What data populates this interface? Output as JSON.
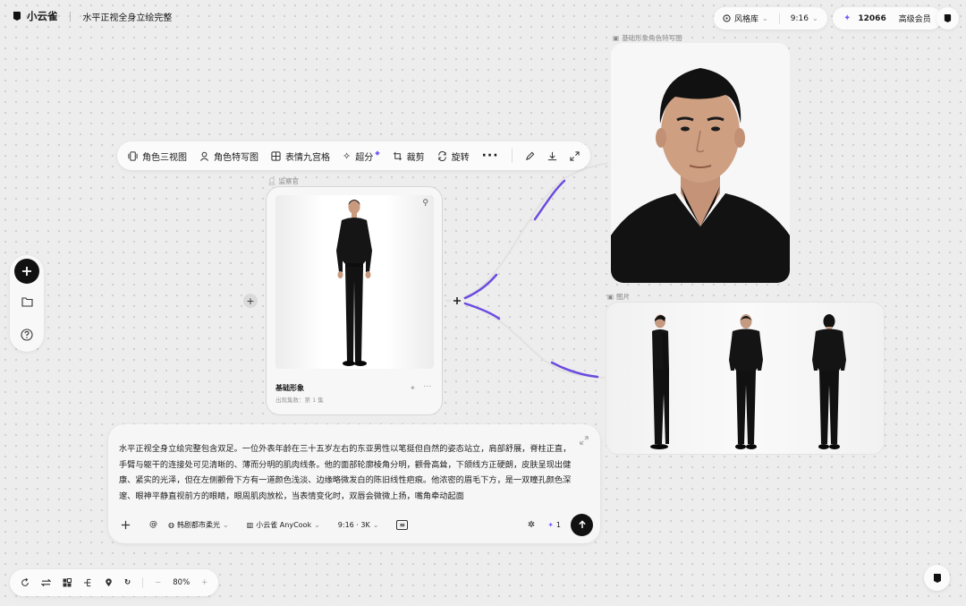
{
  "app": {
    "name": "小云雀",
    "project_title": "水平正视全身立绘完整"
  },
  "topbar": {
    "style_lib": "风格库",
    "ratio": "9:16",
    "credits": "12066",
    "membership": "高级会员"
  },
  "toolbar": {
    "items": [
      "角色三视图",
      "角色特写图",
      "表情九宫格",
      "超分",
      "裁剪",
      "旋转"
    ]
  },
  "node_labels": {
    "observer": "监察官",
    "portrait": "基础形象角色特写图",
    "turnaround": "图片"
  },
  "card": {
    "title": "基础形象",
    "subtitle": "出现集数：第 1 集"
  },
  "prompt": {
    "text": "水平正视全身立绘完整包含双足。一位外表年龄在三十五岁左右的东亚男性以笔挺但自然的姿态站立，肩部舒展，脊柱正直，手臂与躯干的连接处可见清晰的、薄而分明的肌肉线条。他的面部轮廓棱角分明，颧骨高耸，下颌线方正硬朗，皮肤呈现出健康、紧实的光泽，但在左侧颧骨下方有一道颜色浅淡、边缘略微发白的陈旧线性疤痕。他浓密的眉毛下方，是一双瞳孔颜色深邃、眼神平静直视前方的眼睛，眼周肌肉放松，当表情变化时，双唇会微微上扬，嘴角牵动起面",
    "style": "韩剧都市柔光",
    "model": "小云雀 AnyCook",
    "spec": "9:16 · 3K",
    "count": "1"
  },
  "zoom": "80%"
}
